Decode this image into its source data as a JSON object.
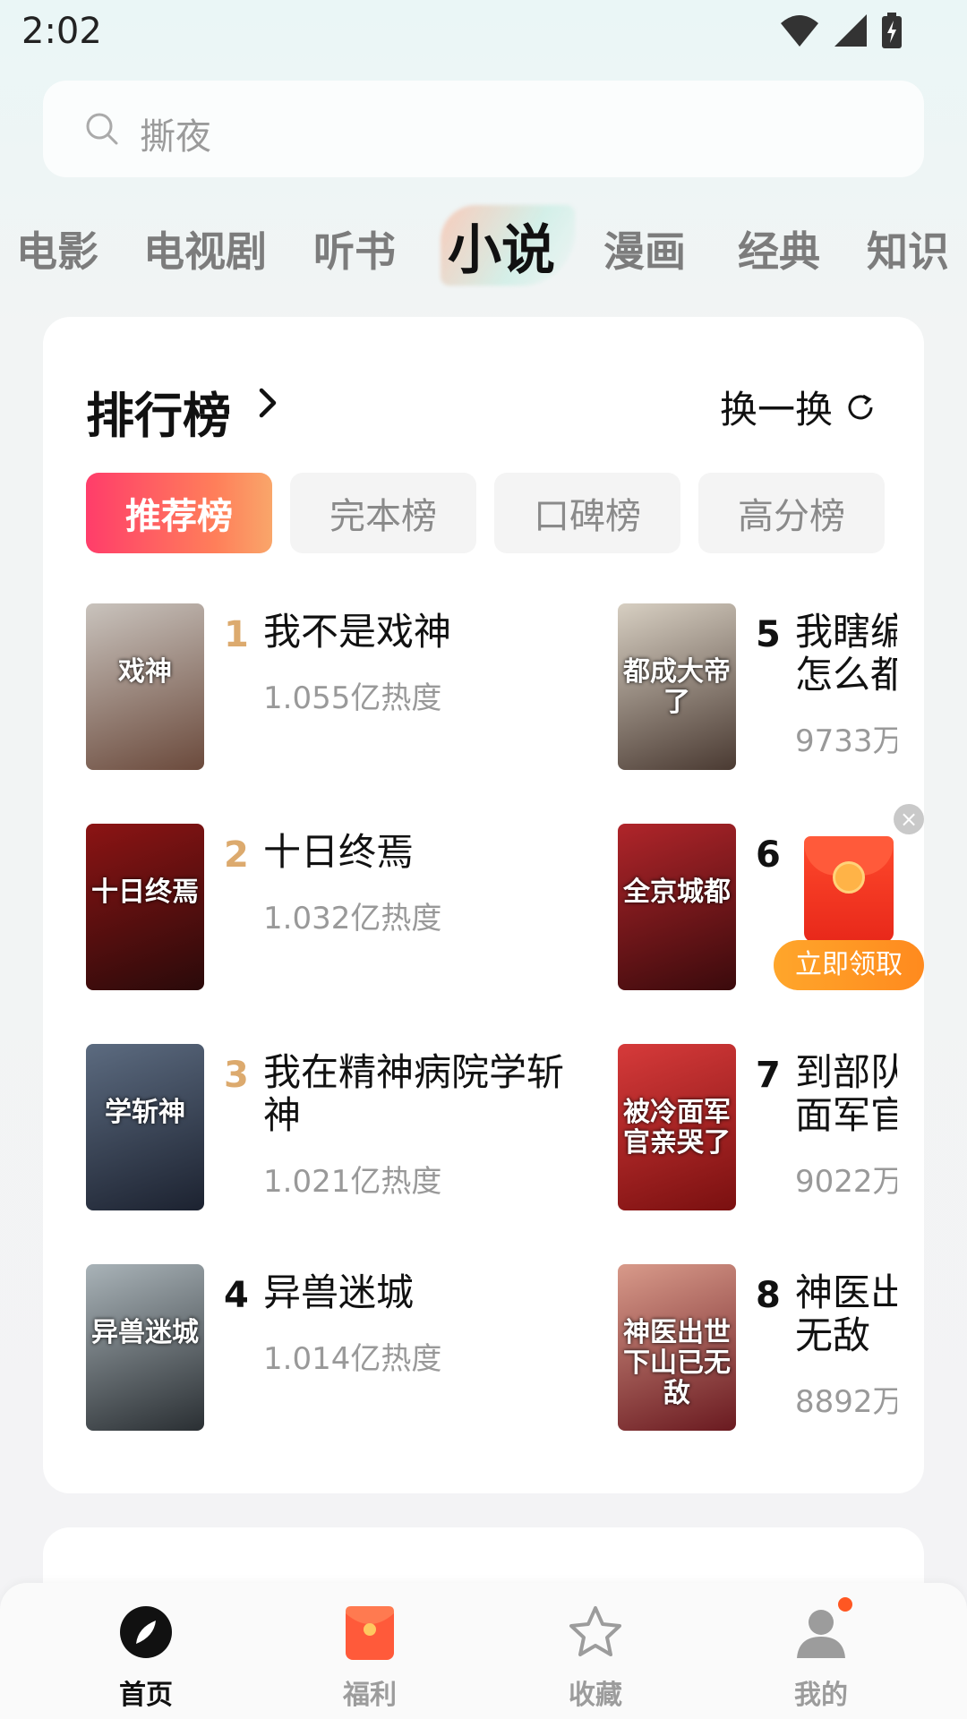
{
  "status_bar": {
    "time": "2:02"
  },
  "search": {
    "placeholder": "撕夜"
  },
  "category_tabs": [
    "电影",
    "电视剧",
    "听书",
    "小说",
    "漫画",
    "经典",
    "知识"
  ],
  "ranking": {
    "title": "排行榜",
    "refresh_label": "换一换",
    "tabs": [
      "推荐榜",
      "完本榜",
      "口碑榜",
      "高分榜"
    ],
    "books": [
      {
        "rank": "1",
        "title": "我不是戏神",
        "heat": "1.055亿热度",
        "cover_text": "戏神",
        "cover_colors": [
          "#c9c3bd",
          "#6b4a3c"
        ]
      },
      {
        "rank": "2",
        "title": "十日终焉",
        "heat": "1.032亿热度",
        "cover_text": "十日终焉",
        "cover_colors": [
          "#8c1414",
          "#2a0a0a"
        ]
      },
      {
        "rank": "3",
        "title": "我在精神病院学斩神",
        "heat": "1.021亿热度",
        "cover_text": "学斩神",
        "cover_colors": [
          "#5c6b80",
          "#1c2230"
        ]
      },
      {
        "rank": "4",
        "title": "异兽迷城",
        "heat": "1.014亿热度",
        "cover_text": "异兽迷城",
        "cover_colors": [
          "#a9b3b8",
          "#2a2f33"
        ]
      },
      {
        "rank": "5",
        "title": "我瞎编",
        "title2": "怎么都",
        "heat": "9733万",
        "cover_text": "都成大帝了",
        "cover_colors": [
          "#d7cfc2",
          "#4a3a32"
        ]
      },
      {
        "rank": "6",
        "title": "",
        "heat": "",
        "cover_text": "全京城都",
        "cover_colors": [
          "#b0252a",
          "#3a0a0c"
        ]
      },
      {
        "rank": "7",
        "title": "到部队",
        "title2": "面军官",
        "heat": "9022万",
        "cover_text": "被冷面军官亲哭了",
        "cover_colors": [
          "#d63a3a",
          "#7a1010"
        ]
      },
      {
        "rank": "8",
        "title": "神医出",
        "title2": "无敌",
        "heat": "8892万",
        "cover_text": "神医出世下山已无敌",
        "cover_colors": [
          "#d89a8a",
          "#6a1a20"
        ]
      }
    ]
  },
  "red_packet": {
    "button_label": "立即领取",
    "close_symbol": "×"
  },
  "bottom_nav": [
    {
      "label": "首页",
      "icon": "compass-icon",
      "active": true
    },
    {
      "label": "福利",
      "icon": "red-packet-icon",
      "active": false
    },
    {
      "label": "收藏",
      "icon": "star-icon",
      "active": false
    },
    {
      "label": "我的",
      "icon": "user-icon",
      "active": false
    }
  ],
  "colors": {
    "accent_gradient_start": "#ff3d6a",
    "accent_gradient_end": "#f9a66a",
    "rank_gold": "#dcaa6e",
    "notification_dot": "#ff5722"
  }
}
